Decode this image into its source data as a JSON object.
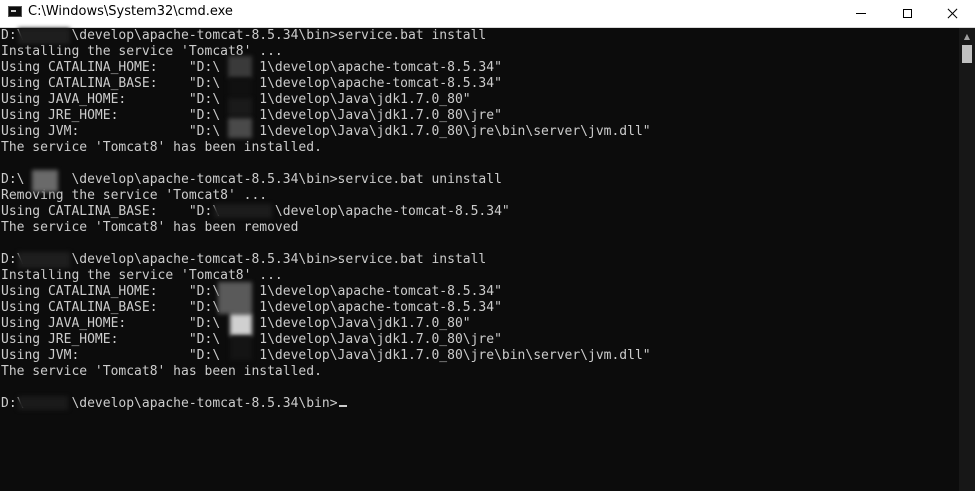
{
  "window": {
    "title": "C:\\Windows\\System32\\cmd.exe"
  },
  "icons": {
    "app": "cmd-icon",
    "minimize": "minimize-icon",
    "maximize": "maximize-icon",
    "close": "close-icon"
  },
  "colors": {
    "console_bg": "#0c0c0c",
    "console_text": "#cccccc",
    "titlebar_bg": "#ffffff"
  },
  "console": {
    "lines": [
      "D:\\      \\develop\\apache-tomcat-8.5.34\\bin>service.bat install",
      "Installing the service 'Tomcat8' ...",
      "Using CATALINA_HOME:    \"D:\\     1\\develop\\apache-tomcat-8.5.34\"",
      "Using CATALINA_BASE:    \"D:\\     1\\develop\\apache-tomcat-8.5.34\"",
      "Using JAVA_HOME:        \"D:\\     1\\develop\\Java\\jdk1.7.0_80\"",
      "Using JRE_HOME:         \"D:\\     1\\develop\\Java\\jdk1.7.0_80\\jre\"",
      "Using JVM:              \"D:\\     1\\develop\\Java\\jdk1.7.0_80\\jre\\bin\\server\\jvm.dll\"",
      "The service 'Tomcat8' has been installed.",
      "",
      "D:\\      \\develop\\apache-tomcat-8.5.34\\bin>service.bat uninstall",
      "Removing the service 'Tomcat8' ...",
      "Using CATALINA_BASE:    \"D:\\       \\develop\\apache-tomcat-8.5.34\"",
      "The service 'Tomcat8' has been removed",
      "",
      "D:\\      \\develop\\apache-tomcat-8.5.34\\bin>service.bat install",
      "Installing the service 'Tomcat8' ...",
      "Using CATALINA_HOME:    \"D:\\     1\\develop\\apache-tomcat-8.5.34\"",
      "Using CATALINA_BASE:    \"D:\\     1\\develop\\apache-tomcat-8.5.34\"",
      "Using JAVA_HOME:        \"D:\\     1\\develop\\Java\\jdk1.7.0_80\"",
      "Using JRE_HOME:         \"D:\\     1\\develop\\Java\\jdk1.7.0_80\\jre\"",
      "Using JVM:              \"D:\\     1\\develop\\Java\\jdk1.7.0_80\\jre\\bin\\server\\jvm.dll\"",
      "The service 'Tomcat8' has been installed.",
      "",
      "D:\\      \\develop\\apache-tomcat-8.5.34\\bin>"
    ]
  }
}
